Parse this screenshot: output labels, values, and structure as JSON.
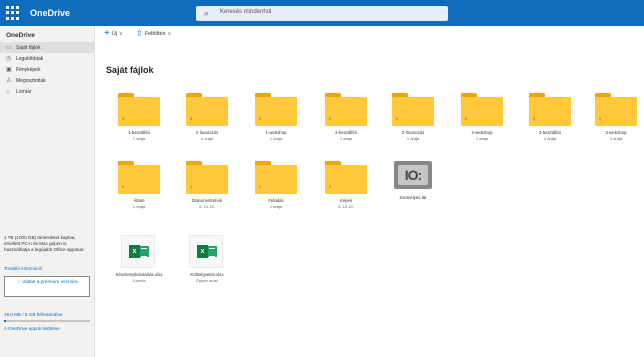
{
  "header": {
    "app_name": "OneDrive",
    "search_placeholder": "Keresés mindenhol"
  },
  "sidebar": {
    "title": "OneDrive",
    "items": [
      {
        "label": "Saját fájlok",
        "icon": "folder-icon",
        "active": true
      },
      {
        "label": "Legutóbbiak",
        "icon": "clock-icon",
        "active": false
      },
      {
        "label": "Fényképek",
        "icon": "photo-icon",
        "active": false
      },
      {
        "label": "Megosztottak",
        "icon": "people-icon",
        "active": false
      },
      {
        "label": "Lomtár",
        "icon": "trash-icon",
        "active": false
      }
    ],
    "info_text": "1 TB (1000 GB) tárterületet kaphat, emellett PC-n és Mac gépen is használhatja a legújabb Office-appokat.",
    "info_link": "További információ",
    "premium_button": "Váltás a prémium verzióra",
    "storage_text": "18,0 MB / 5 GB felhasználva",
    "storage_used_fraction": 0.01,
    "apps_link": "A OneDrive appok letöltése"
  },
  "toolbar": {
    "new_label": "Új",
    "upload_label": "Feltöltés"
  },
  "main": {
    "title": "Saját fájlok",
    "items": [
      {
        "type": "folder",
        "name": "1-beszállító",
        "meta": "1 órája",
        "count": "0"
      },
      {
        "type": "folder",
        "name": "1-fuvarozás",
        "meta": "1 órája",
        "count": "0"
      },
      {
        "type": "folder",
        "name": "1-webshop",
        "meta": "1 órája",
        "count": "0"
      },
      {
        "type": "folder",
        "name": "2-beszállító",
        "meta": "1 órája",
        "count": "0"
      },
      {
        "type": "folder",
        "name": "2-fuvarozás",
        "meta": "1 órája",
        "count": "0"
      },
      {
        "type": "folder",
        "name": "2-webshop",
        "meta": "1 órája",
        "count": "0"
      },
      {
        "type": "folder",
        "name": "3-beszállító",
        "meta": "1 órája",
        "count": "0"
      },
      {
        "type": "folder",
        "name": "3-webshop",
        "meta": "1 órája",
        "count": "0"
      },
      {
        "type": "folder",
        "name": "Átlam",
        "meta": "1 órája",
        "count": "0"
      },
      {
        "type": "folder",
        "name": "Dokumentumok",
        "meta": "8. 10.13.",
        "count": "0"
      },
      {
        "type": "folder",
        "name": "Feladás",
        "meta": "1 órája",
        "count": "1"
      },
      {
        "type": "folder",
        "name": "Képek",
        "meta": "8. 10.13.",
        "count": "0"
      },
      {
        "type": "vault",
        "name": "Személyes tár",
        "meta": ""
      },
      {
        "type": "excel",
        "name": "Készletnyilvántartás.xlsx",
        "meta": "3 perce"
      },
      {
        "type": "excel",
        "name": "Költségvetés.xlsx",
        "meta": "Éppen most"
      }
    ]
  },
  "colors": {
    "brand": "#0f6cbd",
    "folder": "#ffc83d",
    "excel": "#107c41"
  }
}
